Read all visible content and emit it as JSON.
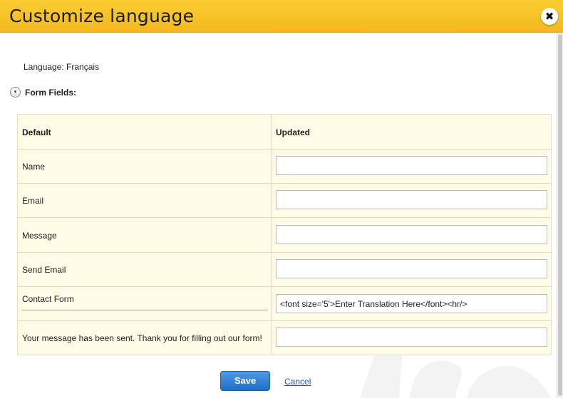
{
  "dialog": {
    "title": "Customize language",
    "close_label": "✖"
  },
  "language_line": "Language: Français",
  "section": {
    "toggle_glyph": "▾",
    "label": "Form Fields:"
  },
  "table": {
    "headers": {
      "default": "Default",
      "updated": "Updated"
    },
    "rows": [
      {
        "default": "Name",
        "value": "",
        "placeholder": ""
      },
      {
        "default": "Email",
        "value": "",
        "placeholder": ""
      },
      {
        "default": "Message",
        "value": "",
        "placeholder": ""
      },
      {
        "default": "Send Email",
        "value": "",
        "placeholder": ""
      },
      {
        "default": "Contact Form",
        "value": "<font size='5'>Enter Translation Here</font><hr/>",
        "placeholder": ""
      },
      {
        "default": "Your message has been sent. Thank you for filling out our form!",
        "value": "",
        "placeholder": ""
      }
    ]
  },
  "actions": {
    "save_label": "Save",
    "cancel_label": "Cancel"
  },
  "colors": {
    "title_bar": "#f6bf24",
    "table_bg": "#fffbe6",
    "save_button": "#2a78cf",
    "link": "#1f56c0"
  }
}
